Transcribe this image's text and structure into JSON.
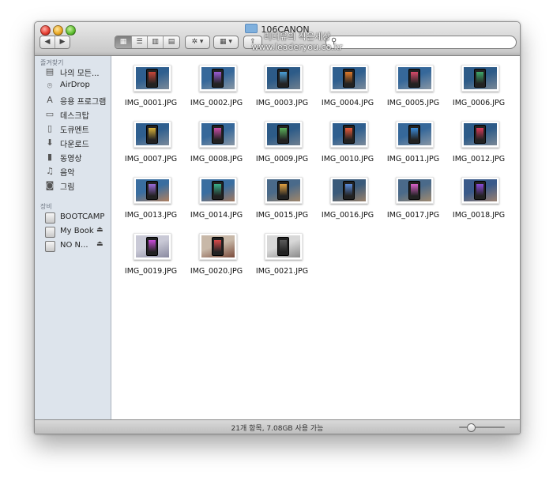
{
  "window": {
    "title": "106CANON",
    "watermark_line1": "리더유의 작은세상",
    "watermark_line2": "www.leaderyou.co.kr"
  },
  "toolbar": {
    "back": "◀",
    "forward": "▶",
    "view_icons": "▦",
    "view_list": "☰",
    "view_columns": "▥",
    "view_coverflow": "▤",
    "action": "✲ ▾",
    "arrange": "▦ ▾",
    "share": "⇪",
    "search_placeholder": "",
    "search_icon": "search-icon"
  },
  "sidebar": {
    "favorites_header": "즐겨찾기",
    "favorites": [
      {
        "label": "나의 모든...",
        "icon": "all-files-icon",
        "glyph": "▤"
      },
      {
        "label": "AirDrop",
        "icon": "airdrop-icon",
        "glyph": "⌾"
      },
      {
        "label": "응용 프로그램",
        "icon": "applications-icon",
        "glyph": "A"
      },
      {
        "label": "데스크탑",
        "icon": "desktop-icon",
        "glyph": "▭"
      },
      {
        "label": "도큐멘트",
        "icon": "documents-icon",
        "glyph": "▯"
      },
      {
        "label": "다운로드",
        "icon": "downloads-icon",
        "glyph": "⬇"
      },
      {
        "label": "동영상",
        "icon": "movies-icon",
        "glyph": "▮"
      },
      {
        "label": "음악",
        "icon": "music-icon",
        "glyph": "♫"
      },
      {
        "label": "그림",
        "icon": "pictures-icon",
        "glyph": "◙"
      }
    ],
    "devices_header": "장비",
    "devices": [
      {
        "label": "BOOTCAMP",
        "eject": ""
      },
      {
        "label": "My Book",
        "eject": "⏏"
      },
      {
        "label": "NO N...",
        "eject": "⏏"
      }
    ]
  },
  "files": [
    {
      "name": "IMG_0001.JPG",
      "colors": [
        "#2f5f8f",
        "#7b8a9a",
        "#c9473a"
      ]
    },
    {
      "name": "IMG_0002.JPG",
      "colors": [
        "#36689a",
        "#8896a4",
        "#9b5bd6"
      ]
    },
    {
      "name": "IMG_0003.JPG",
      "colors": [
        "#2d5b88",
        "#6f7f8f",
        "#4a9fd8"
      ]
    },
    {
      "name": "IMG_0004.JPG",
      "colors": [
        "#2f5f8f",
        "#7b8a9a",
        "#e07a2a"
      ]
    },
    {
      "name": "IMG_0005.JPG",
      "colors": [
        "#36689a",
        "#8896a4",
        "#d84a6a"
      ]
    },
    {
      "name": "IMG_0006.JPG",
      "colors": [
        "#2d5b88",
        "#7a8896",
        "#3fa86a"
      ]
    },
    {
      "name": "IMG_0007.JPG",
      "colors": [
        "#2f5f8f",
        "#7b8a9a",
        "#d9b23a"
      ]
    },
    {
      "name": "IMG_0008.JPG",
      "colors": [
        "#36689a",
        "#8896a4",
        "#c94da8"
      ]
    },
    {
      "name": "IMG_0009.JPG",
      "colors": [
        "#2d5b88",
        "#6f7f8f",
        "#5ab05a"
      ]
    },
    {
      "name": "IMG_0010.JPG",
      "colors": [
        "#2f5f8f",
        "#7b8a9a",
        "#e85a3a"
      ]
    },
    {
      "name": "IMG_0011.JPG",
      "colors": [
        "#36689a",
        "#8896a4",
        "#3a8ad8"
      ]
    },
    {
      "name": "IMG_0012.JPG",
      "colors": [
        "#2d5b88",
        "#7a8896",
        "#d83a5a"
      ]
    },
    {
      "name": "IMG_0013.JPG",
      "colors": [
        "#3a6ea0",
        "#b08060",
        "#9a6ad8"
      ]
    },
    {
      "name": "IMG_0014.JPG",
      "colors": [
        "#3a6ea0",
        "#a07860",
        "#3ab08a"
      ]
    },
    {
      "name": "IMG_0015.JPG",
      "colors": [
        "#4a6a8a",
        "#a0866a",
        "#e0a040"
      ]
    },
    {
      "name": "IMG_0016.JPG",
      "colors": [
        "#3a5a7a",
        "#98806a",
        "#5a8ad8"
      ]
    },
    {
      "name": "IMG_0017.JPG",
      "colors": [
        "#4a6a8a",
        "#a08a70",
        "#d860c8"
      ]
    },
    {
      "name": "IMG_0018.JPG",
      "colors": [
        "#3a5a8a",
        "#9a8070",
        "#8a4ad8"
      ]
    },
    {
      "name": "IMG_0019.JPG",
      "colors": [
        "#c9c9d6",
        "#8a8aa0",
        "#c84ad8"
      ]
    },
    {
      "name": "IMG_0020.JPG",
      "colors": [
        "#c8b8a8",
        "#7a4a3a",
        "#d84a4a"
      ]
    },
    {
      "name": "IMG_0021.JPG",
      "colors": [
        "#d8d8d8",
        "#8a8a8a",
        "#5a5a5a"
      ]
    }
  ],
  "status": {
    "text": "21개 항목, 7.08GB 사용 가능",
    "zoom_level": 0.25
  }
}
